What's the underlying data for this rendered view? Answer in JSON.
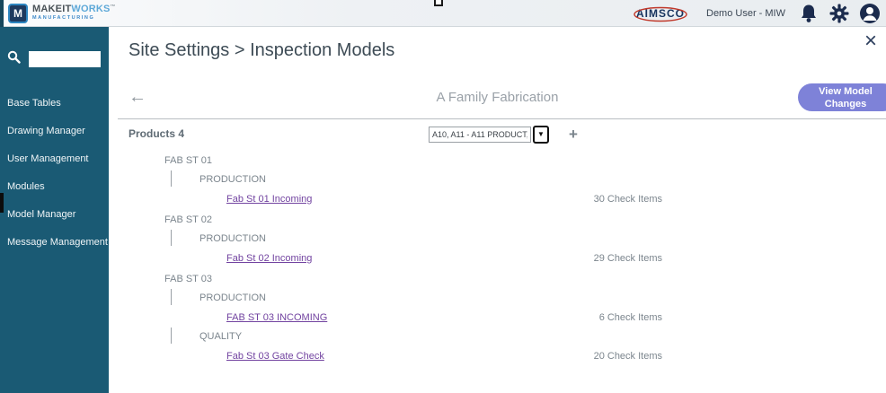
{
  "topbar": {
    "brand": {
      "icon_letter": "M",
      "part1": "MAKEIT",
      "part2": "WORKS",
      "tm": "™",
      "subtitle": "MANUFACTURING"
    },
    "aimsco": "AIMSCO",
    "user": "Demo User - MIW"
  },
  "sidebar": {
    "search_value": "",
    "items": [
      "Base Tables",
      "Drawing Manager",
      "User Management",
      "Modules",
      "Model Manager",
      "Message Management"
    ]
  },
  "header": {
    "title": "Site Settings > Inspection Models",
    "close": "×"
  },
  "toolbar": {
    "back": "←",
    "family": "A Family Fabrication",
    "view_changes": "View Model Changes"
  },
  "products": {
    "label": "Products 4",
    "dropdown_value": "A10, A11 - A11 PRODUCT,",
    "dropdown_arrow": "▼",
    "add": "+"
  },
  "tree": {
    "stations": [
      {
        "name": "FAB ST 01",
        "groups": [
          {
            "name": "PRODUCTION",
            "models": [
              {
                "label": "Fab St 01 Incoming",
                "check_items": "30 Check Items"
              }
            ]
          }
        ]
      },
      {
        "name": "FAB ST 02",
        "groups": [
          {
            "name": "PRODUCTION",
            "models": [
              {
                "label": "Fab St 02 Incoming",
                "check_items": "29 Check Items"
              }
            ]
          }
        ]
      },
      {
        "name": "FAB ST 03",
        "groups": [
          {
            "name": "PRODUCTION",
            "models": [
              {
                "label": "FAB ST 03 INCOMING",
                "check_items": "6 Check Items"
              }
            ]
          },
          {
            "name": "QUALITY",
            "models": [
              {
                "label": "Fab St 03 Gate Check",
                "check_items": "20 Check Items"
              }
            ]
          }
        ]
      }
    ]
  },
  "colors": {
    "sidebar_teal": "#1a5a74",
    "link_purple": "#7243a0",
    "button_purple": "#7e82d8",
    "icon_navy": "#1b2b4d",
    "accent_red": "#c0392b",
    "text_gray": "#7b858d"
  }
}
